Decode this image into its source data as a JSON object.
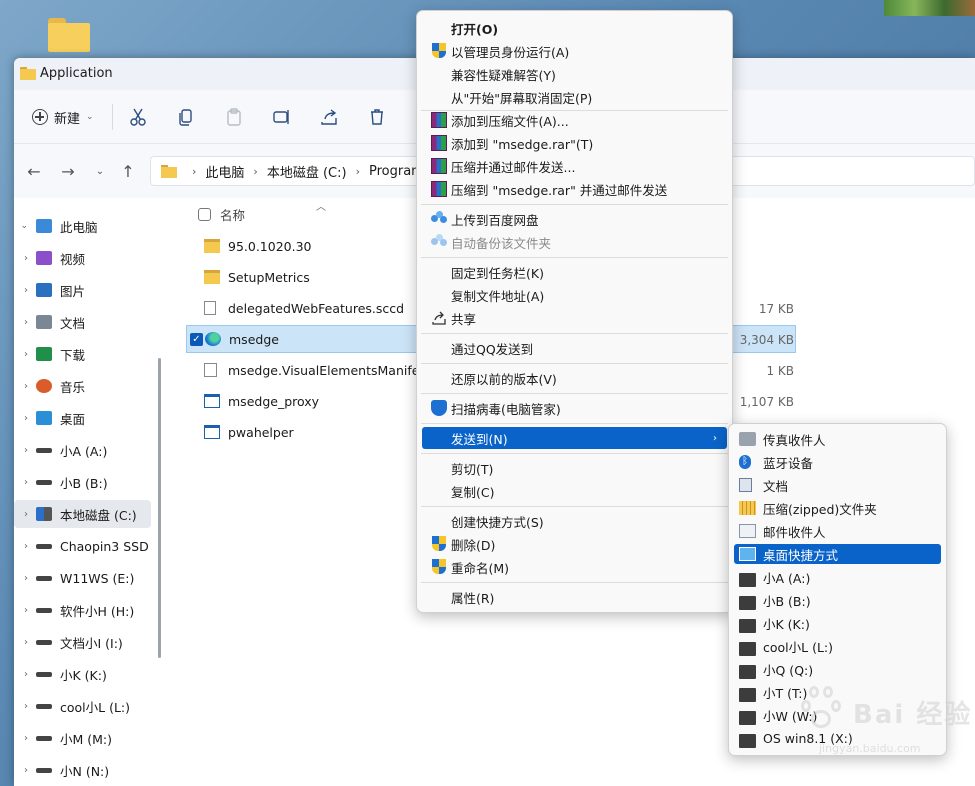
{
  "window": {
    "title": "Application"
  },
  "toolbar": {
    "new_label": "新建"
  },
  "address": {
    "crumbs": [
      "此电脑",
      "本地磁盘 (C:)",
      "Program F"
    ]
  },
  "navpane": {
    "items": [
      {
        "label": "此电脑",
        "expanded": true
      },
      {
        "label": "视频"
      },
      {
        "label": "图片"
      },
      {
        "label": "文档"
      },
      {
        "label": "下载"
      },
      {
        "label": "音乐"
      },
      {
        "label": "桌面"
      },
      {
        "label": "小A (A:)"
      },
      {
        "label": "小B (B:)"
      },
      {
        "label": "本地磁盘 (C:)",
        "selected": true
      },
      {
        "label": "Chaopin3 SSD"
      },
      {
        "label": "W11WS (E:)"
      },
      {
        "label": "软件小H (H:)"
      },
      {
        "label": "文档小I (I:)"
      },
      {
        "label": "小K (K:)"
      },
      {
        "label": "cool小L (L:)"
      },
      {
        "label": "小M (M:)"
      },
      {
        "label": "小N (N:)"
      }
    ]
  },
  "filelist": {
    "column_name": "名称",
    "files": [
      {
        "name": "95.0.1020.30",
        "type": "folder",
        "size": ""
      },
      {
        "name": "SetupMetrics",
        "type": "folder",
        "size": ""
      },
      {
        "name": "delegatedWebFeatures.sccd",
        "type": "file",
        "size": "17 KB"
      },
      {
        "name": "msedge",
        "type": "edge",
        "size": "3,304 KB",
        "selected": true
      },
      {
        "name": "msedge.VisualElementsManifest",
        "type": "manifest",
        "size": "1 KB"
      },
      {
        "name": "msedge_proxy",
        "type": "exe",
        "size": "1,107 KB"
      },
      {
        "name": "pwahelper",
        "type": "exe",
        "size": ""
      }
    ]
  },
  "context_menu": {
    "items": [
      {
        "label": "打开(O)",
        "bold": true
      },
      {
        "label": "以管理员身份运行(A)",
        "icon": "shield-icon"
      },
      {
        "label": "兼容性疑难解答(Y)"
      },
      {
        "label": "从\"开始\"屏幕取消固定(P)"
      },
      {
        "label": "添加到压缩文件(A)...",
        "icon": "winrar-icon"
      },
      {
        "label": "添加到 \"msedge.rar\"(T)",
        "icon": "winrar-icon"
      },
      {
        "label": "压缩并通过邮件发送...",
        "icon": "winrar-icon"
      },
      {
        "label": "压缩到 \"msedge.rar\" 并通过邮件发送",
        "icon": "winrar-icon"
      },
      {
        "label": "上传到百度网盘",
        "icon": "baidu-icon"
      },
      {
        "label": "自动备份该文件夹",
        "icon": "baidu-icon",
        "disabled": true
      },
      {
        "label": "固定到任务栏(K)"
      },
      {
        "label": "复制文件地址(A)"
      },
      {
        "label": "共享",
        "icon": "share-icon"
      },
      {
        "label": "通过QQ发送到"
      },
      {
        "label": "还原以前的版本(V)"
      },
      {
        "label": "扫描病毒(电脑管家)",
        "icon": "pcmgr-icon"
      },
      {
        "label": "发送到(N)",
        "highlighted": true,
        "submenu": true
      },
      {
        "label": "剪切(T)"
      },
      {
        "label": "复制(C)"
      },
      {
        "label": "创建快捷方式(S)"
      },
      {
        "label": "删除(D)",
        "icon": "shield-icon"
      },
      {
        "label": "重命名(M)",
        "icon": "shield-icon"
      },
      {
        "label": "属性(R)"
      }
    ]
  },
  "sendto_menu": {
    "items": [
      {
        "label": "传真收件人",
        "icon": "fax-icon"
      },
      {
        "label": "蓝牙设备",
        "icon": "bluetooth-icon"
      },
      {
        "label": "文档",
        "icon": "document-icon"
      },
      {
        "label": "压缩(zipped)文件夹",
        "icon": "zip-folder-icon"
      },
      {
        "label": "邮件收件人",
        "icon": "mail-icon"
      },
      {
        "label": "桌面快捷方式",
        "icon": "desktop-icon",
        "highlighted": true
      },
      {
        "label": "小A (A:)",
        "icon": "drive-icon"
      },
      {
        "label": "小B (B:)",
        "icon": "drive-icon"
      },
      {
        "label": "小K (K:)",
        "icon": "drive-icon"
      },
      {
        "label": "cool小L (L:)",
        "icon": "drive-icon"
      },
      {
        "label": "小Q (Q:)",
        "icon": "drive-icon"
      },
      {
        "label": "小T (T:)",
        "icon": "drive-icon"
      },
      {
        "label": "小W (W:)",
        "icon": "drive-icon"
      },
      {
        "label": "OS win8.1 (X:)",
        "icon": "drive-icon"
      }
    ]
  },
  "watermark": {
    "text": "Bai 经验",
    "url": "jingyan.baidu.com"
  },
  "colors": {
    "accent": "#0a63c9",
    "selection": "#cce4f7",
    "folder": "#f5c84f"
  }
}
